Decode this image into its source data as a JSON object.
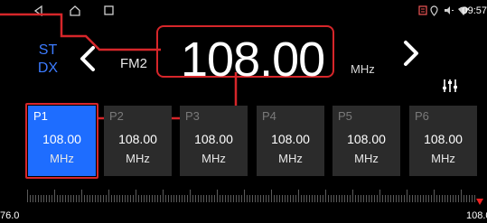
{
  "statusbar": {
    "time": "09:57"
  },
  "header": {
    "st": "ST",
    "dx": "DX",
    "band": "FM2",
    "frequency": "108.00",
    "unit": "MHz"
  },
  "presets": [
    {
      "name": "P1",
      "value": "108.00",
      "unit": "MHz",
      "active": true
    },
    {
      "name": "P2",
      "value": "108.00",
      "unit": "MHz",
      "active": false
    },
    {
      "name": "P3",
      "value": "108.00",
      "unit": "MHz",
      "active": false
    },
    {
      "name": "P4",
      "value": "108.00",
      "unit": "MHz",
      "active": false
    },
    {
      "name": "P5",
      "value": "108.00",
      "unit": "MHz",
      "active": false
    },
    {
      "name": "P6",
      "value": "108.00",
      "unit": "MHz",
      "active": false
    }
  ],
  "scale": {
    "min_label": "76.0",
    "max_label": "108.0"
  },
  "colors": {
    "accent": "#1e6dff",
    "stdx": "#3c7bff",
    "annotation": "#d6262a"
  },
  "icons": [
    "back-nav-icon",
    "home-nav-icon",
    "recents-nav-icon",
    "sim-icon",
    "location-icon",
    "volume-icon",
    "wifi-icon",
    "prev-station-icon",
    "next-station-icon",
    "equalizer-icon"
  ]
}
